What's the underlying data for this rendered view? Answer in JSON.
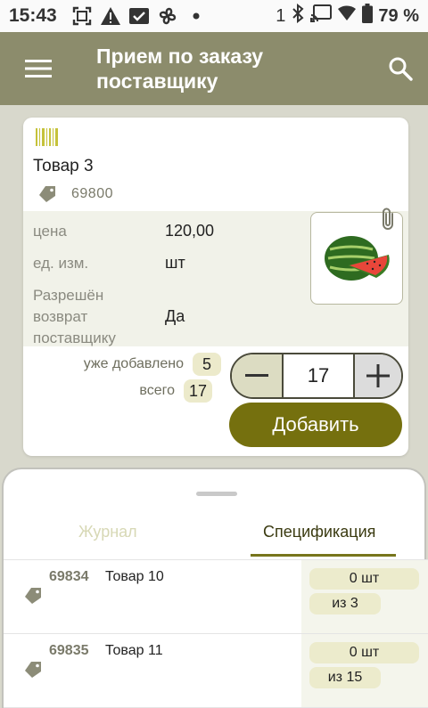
{
  "status_bar": {
    "time": "15:43",
    "notification_count": "1",
    "battery": "79 %",
    "icons": [
      "scan-icon",
      "warning-icon",
      "mail-check-icon",
      "fan-icon",
      "dot-icon",
      "bluetooth-icon",
      "cast-icon",
      "wifi-icon",
      "battery-icon"
    ]
  },
  "app_bar": {
    "title": "Прием по заказу\nпоставщику"
  },
  "product": {
    "name": "Товар 3",
    "code": "69800",
    "props": [
      {
        "label": "цена",
        "value": "120,00"
      },
      {
        "label": "ед. изм.",
        "value": "шт"
      },
      {
        "label": "Разрешён\nвозврат\nпоставщику",
        "value": "Да"
      }
    ],
    "image": "watermelon"
  },
  "counters": {
    "added_label": "уже добавлено",
    "added_value": "5",
    "total_label": "всего",
    "total_value": "17"
  },
  "stepper": {
    "quantity": "17"
  },
  "add_button_label": "Добавить",
  "sheet": {
    "tabs": [
      {
        "label": "Журнал",
        "active": false
      },
      {
        "label": "Спецификация",
        "active": true
      }
    ],
    "rows": [
      {
        "code": "69834",
        "name": "Товар 10",
        "qty": "0 шт",
        "of": "из 3"
      },
      {
        "code": "69835",
        "name": "Товар 11",
        "qty": "0 шт",
        "of": "из 15"
      }
    ]
  },
  "colors": {
    "app_bar": "#8c8c6c",
    "accent": "#75700e",
    "pill": "#ecebcc"
  }
}
